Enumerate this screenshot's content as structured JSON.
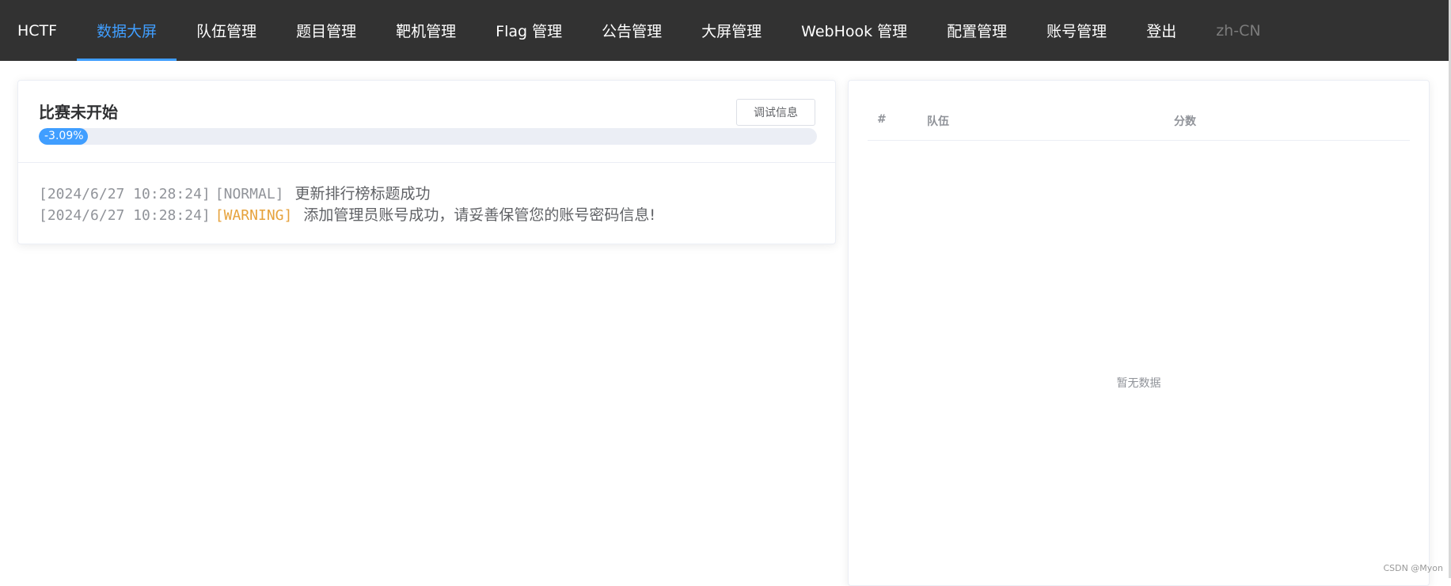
{
  "nav": {
    "brand": "HCTF",
    "items": [
      {
        "label": "数据大屏",
        "active": true
      },
      {
        "label": "队伍管理",
        "active": false
      },
      {
        "label": "题目管理",
        "active": false
      },
      {
        "label": "靶机管理",
        "active": false
      },
      {
        "label": "Flag 管理",
        "active": false
      },
      {
        "label": "公告管理",
        "active": false
      },
      {
        "label": "大屏管理",
        "active": false
      },
      {
        "label": "WebHook 管理",
        "active": false
      },
      {
        "label": "配置管理",
        "active": false
      },
      {
        "label": "账号管理",
        "active": false
      },
      {
        "label": "登出",
        "active": false
      }
    ],
    "lang": "zh-CN"
  },
  "status": {
    "title": "比赛未开始",
    "debug_button": "调试信息",
    "progress_text": "-3.09%",
    "progress_value": -3.09
  },
  "logs": [
    {
      "time": "[2024/6/27 10:28:24]",
      "level": "[NORMAL]",
      "message": "更新排行榜标题成功"
    },
    {
      "time": "[2024/6/27 10:28:24]",
      "level": "[WARNING]",
      "message": "添加管理员账号成功，请妥善保管您的账号密码信息!"
    }
  ],
  "rank_table": {
    "headers": {
      "rank": "#",
      "team": "队伍",
      "score": "分数"
    },
    "empty_text": "暂无数据"
  },
  "watermark": "CSDN @Myon⁠",
  "colors": {
    "nav_bg": "#323232",
    "accent": "#409eff",
    "warning": "#e6a23c"
  }
}
